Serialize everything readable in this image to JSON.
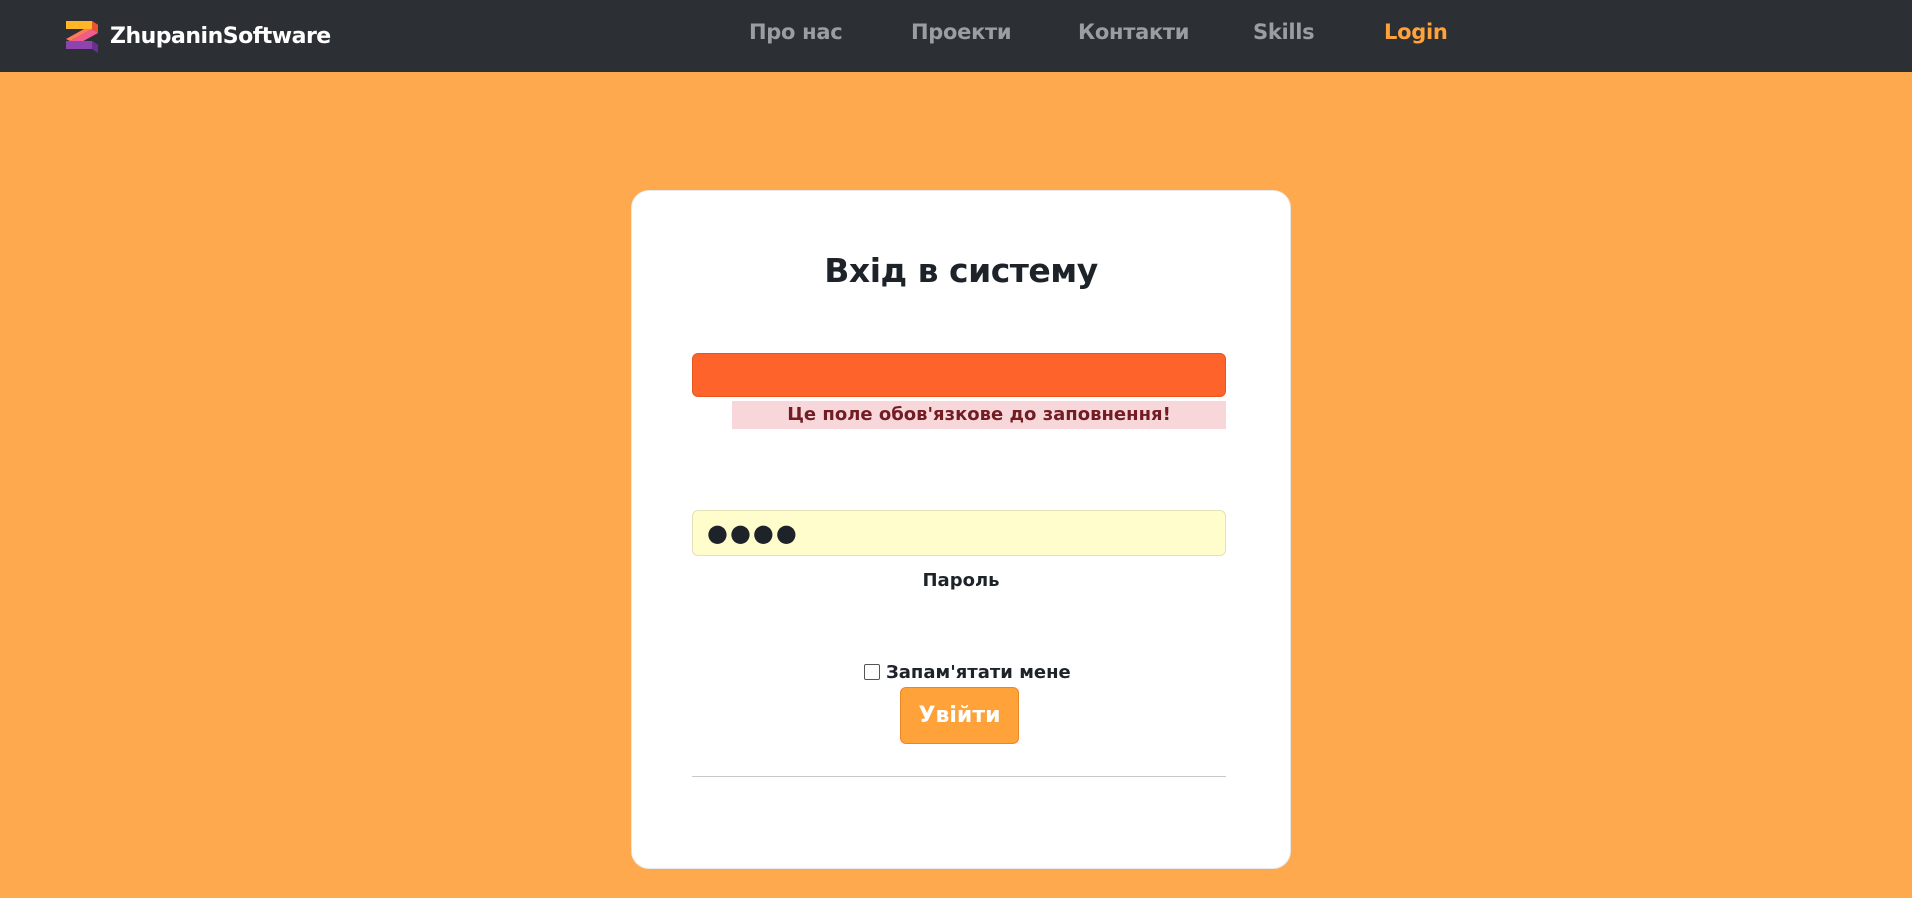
{
  "brand": {
    "name": "ZhupaninSoftware"
  },
  "nav": {
    "items": [
      {
        "label": "Про нас"
      },
      {
        "label": "Проекти"
      },
      {
        "label": "Контакти"
      },
      {
        "label": "Skills"
      },
      {
        "label": "Login",
        "active": true
      }
    ]
  },
  "login": {
    "title": "Вхід в систему",
    "username": {
      "value": "",
      "placeholder": ""
    },
    "error": "Це поле обов'язкове до заповнення!",
    "password": {
      "value": "●●●●",
      "label": "Пароль"
    },
    "remember": {
      "label": "Запам'ятати мене",
      "checked": false
    },
    "submit_label": "Увійти"
  },
  "colors": {
    "navbar_bg": "#2C3035",
    "page_bg": "#FFA94F",
    "accent": "#FFA23A",
    "error_field": "#FF632C",
    "error_bg": "#F8D7DA",
    "error_text": "#721C24",
    "autofill_bg": "#FFFDCB"
  },
  "icons": {
    "brand_logo": "brand-logo-icon",
    "checkbox": "checkbox-icon"
  }
}
